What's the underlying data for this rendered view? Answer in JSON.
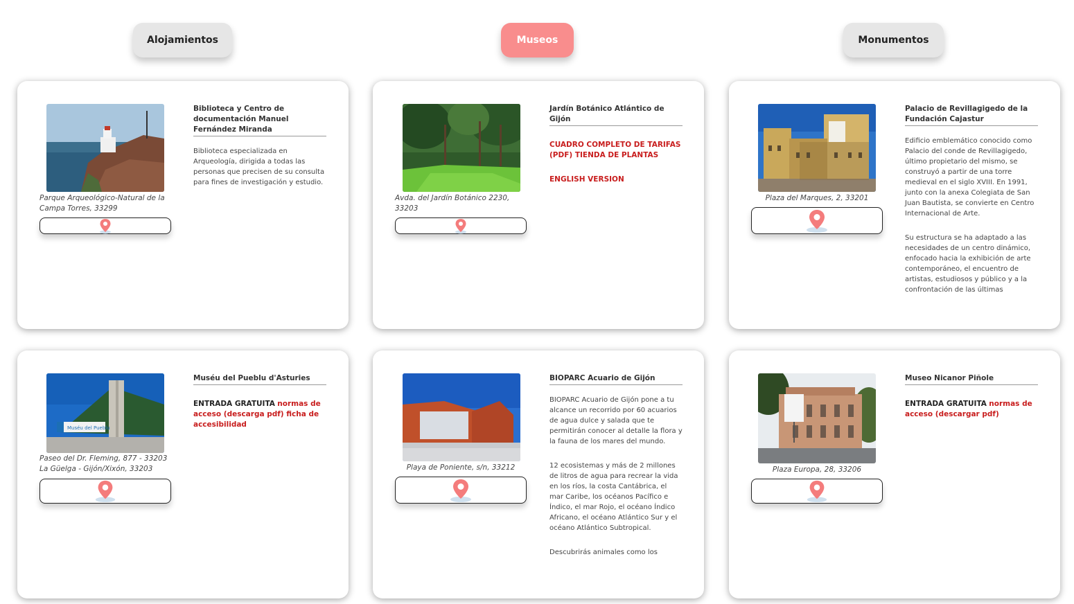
{
  "tabs": [
    {
      "label": "Alojamientos",
      "active": false
    },
    {
      "label": "Museos",
      "active": true
    },
    {
      "label": "Monumentos",
      "active": false
    }
  ],
  "colors": {
    "accent": "#f98d8d",
    "link_red": "#c81d1d",
    "pin": "#f47c7c"
  },
  "cards": [
    {
      "title": "Biblioteca y Centro de documentación Manuel Fernández Miranda",
      "address": "Parque Arqueológico-Natural de la Campa Torres, 33299",
      "image": "lighthouse-cliff-photo",
      "description": "Biblioteca especializada en Arqueología, dirigida a todas las personas que precisen de su consulta para fines de investigación y estudio."
    },
    {
      "title": "Jardín Botánico Atlántico de Gijón",
      "address": "Avda. del Jardín Botánico 2230, 33203",
      "image": "garden-trees-photo",
      "link1": "CUADRO COMPLETO DE TARIFAS (PDF) TIENDA DE PLANTAS",
      "link2": "ENGLISH VERSION"
    },
    {
      "title": "Palacio de Revillagigedo de la Fundación Cajastur",
      "address": "Plaza del Marques, 2, 33201",
      "image": "palace-facade-photo",
      "p1": "Edificio emblemático conocido como Palacio del conde de Revillagigedo, último propietario del mismo, se construyó a partir de una torre medieval en el siglo XVIII. En 1991, junto con la anexa Colegiata de San Juan Bautista, se convierte en Centro Internacional de Arte.",
      "p2": "Su estructura se ha adaptado a las necesidades de un centro dinámico, enfocado hacia la exhibición de arte contemporáneo, el encuentro de artistas, estudiosos y público y a la confrontación de las últimas"
    },
    {
      "title": "Muséu del Pueblu d'Asturies",
      "address": "Paseo del Dr. Fleming, 877 - 33203 La Güelga - Gijón/Xixón, 33203",
      "image": "museum-building-photo",
      "dark": "ENTRADA GRATUITA",
      "red": "normas de acceso (descarga pdf) ficha de accesibilidad"
    },
    {
      "title": "BIOPARC Acuario de Gijón",
      "address": "Playa de Poniente, s/n, 33212",
      "image": "aquarium-building-photo",
      "p1": "BIOPARC Acuario de Gijón pone a tu alcance un recorrido por 60 acuarios de agua dulce y salada que te permitirán conocer al detalle la flora y la fauna de los mares del mundo.",
      "p2": "12 ecosistemas y más de 2 millones de litros de agua para recrear la vida en los ríos, la costa Cantábrica, el mar Caribe, los océanos Pacífico e Índico, el mar Rojo, el océano Índico Africano, el océano Atlántico Sur y el océano Atlántico Subtropical.",
      "p3": "Descubrirás animales como los"
    },
    {
      "title": "Museo Nicanor Piñole",
      "address": "Plaza Europa, 28, 33206",
      "image": "museum-facade-photo",
      "dark": "ENTRADA GRATUITA",
      "red": "normas de acceso (descargar pdf)"
    }
  ]
}
